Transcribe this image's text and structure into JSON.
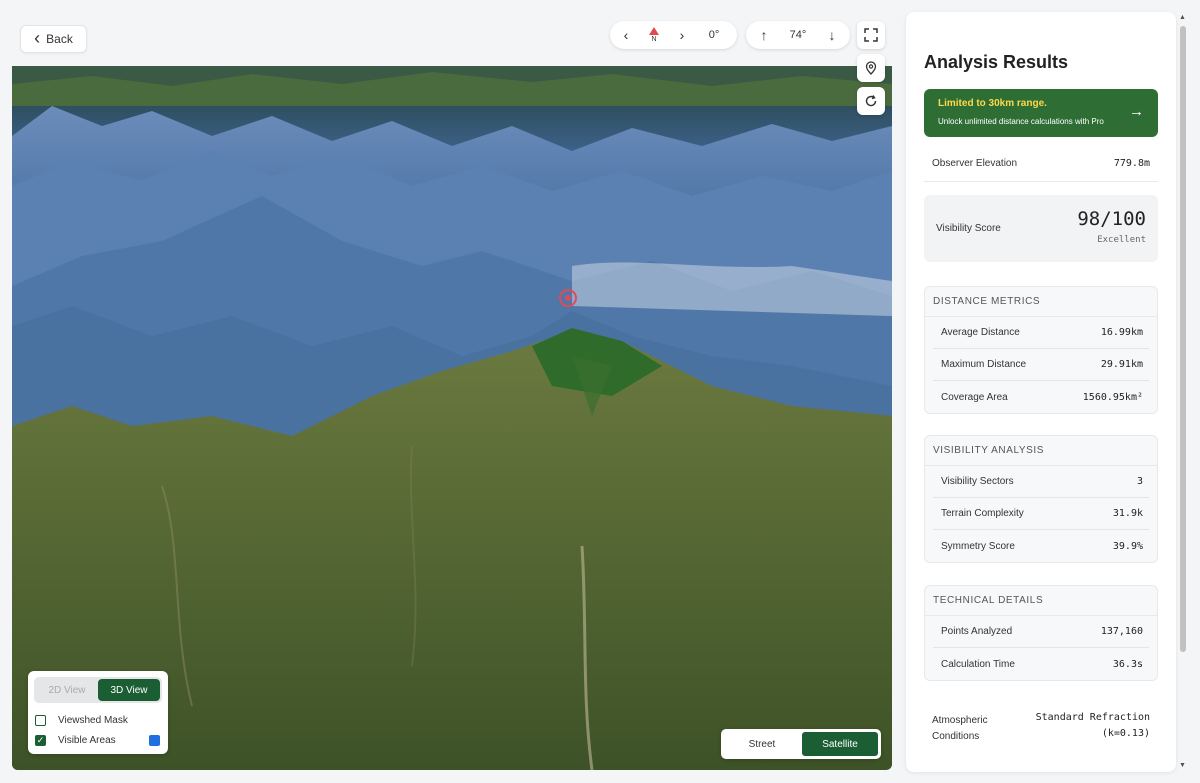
{
  "toolbar": {
    "back_label": "Back",
    "compass_letter": "N",
    "heading": "0°",
    "tilt": "74°"
  },
  "view_controls": {
    "mode_2d": "2D View",
    "mode_3d": "3D View",
    "active_mode": "3D View",
    "layers": [
      {
        "label": "Viewshed Mask",
        "checked": false
      },
      {
        "label": "Visible Areas",
        "checked": true,
        "color": "#1f6fe0"
      }
    ]
  },
  "basemap": {
    "street": "Street",
    "satellite": "Satellite",
    "active": "Satellite"
  },
  "panel": {
    "title": "Analysis Results",
    "promo": {
      "title": "Limited to 30km range.",
      "subtitle": "Unlock unlimited distance calculations with Pro",
      "color": "#2e6e35"
    },
    "observer_elevation": {
      "label": "Observer Elevation",
      "value": "779.8m"
    },
    "visibility_score": {
      "label": "Visibility Score",
      "value": "98/100",
      "rating": "Excellent"
    },
    "distance_metrics": {
      "header": "DISTANCE METRICS",
      "rows": [
        {
          "label": "Average Distance",
          "value": "16.99km"
        },
        {
          "label": "Maximum Distance",
          "value": "29.91km"
        },
        {
          "label": "Coverage Area",
          "value": "1560.95km²"
        }
      ]
    },
    "visibility_analysis": {
      "header": "VISIBILITY ANALYSIS",
      "rows": [
        {
          "label": "Visibility Sectors",
          "value": "3"
        },
        {
          "label": "Terrain Complexity",
          "value": "31.9k"
        },
        {
          "label": "Symmetry Score",
          "value": "39.9%"
        }
      ]
    },
    "technical_details": {
      "header": "TECHNICAL DETAILS",
      "rows": [
        {
          "label": "Points Analyzed",
          "value": "137,160"
        },
        {
          "label": "Calculation Time",
          "value": "36.3s"
        }
      ]
    },
    "atmospheric": {
      "label_line1": "Atmospheric",
      "label_line2": "Conditions",
      "value_line1": "Standard Refraction",
      "value_line2": "(k=0.13)"
    }
  }
}
